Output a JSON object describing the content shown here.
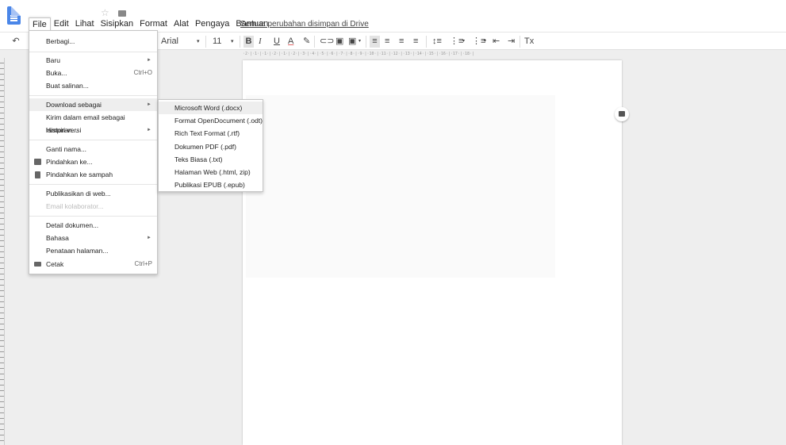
{
  "menubar": {
    "items": [
      "File",
      "Edit",
      "Lihat",
      "Sisipkan",
      "Format",
      "Alat",
      "Pengaya",
      "Bantuan"
    ],
    "saved_status": "Semua perubahan disimpan di Drive"
  },
  "toolbar": {
    "undo": "↶",
    "font": "Arial",
    "font_size": "11",
    "bold": "B",
    "italic": "I",
    "underline": "U",
    "text_color": "A",
    "clear_format": "Tx"
  },
  "ruler_text": "·2·|·1·|·1·|·2·|·1·|·2·|·3·|·4·|·5·|·6·|·7·|·8·|·9·|·10·|·11·|·12·|·13·|·14·|·15·|·16·|·17·|·18·|",
  "file_menu": {
    "share": "Berbagi...",
    "new": "Baru",
    "open": "Buka...",
    "open_shortcut": "Ctrl+O",
    "copy": "Buat salinan...",
    "download": "Download sebagai",
    "email": "Kirim dalam email sebagai lampiran...",
    "history": "Histori versi",
    "rename": "Ganti nama...",
    "move": "Pindahkan ke...",
    "trash": "Pindahkan ke sampah",
    "publish": "Publikasikan di web...",
    "email_collab": "Email kolaborator...",
    "details": "Detail dokumen...",
    "language": "Bahasa",
    "page_setup": "Penataan halaman...",
    "print": "Cetak",
    "print_shortcut": "Ctrl+P"
  },
  "download_submenu": {
    "items": [
      "Microsoft Word (.docx)",
      "Format OpenDocument (.odt)",
      "Rich Text Format (.rtf)",
      "Dokumen PDF (.pdf)",
      "Teks Biasa (.txt)",
      "Halaman Web (.html, zip)",
      "Publikasi EPUB (.epub)"
    ]
  },
  "colors": {
    "doc_blue": "#4a86e8",
    "highlight": "#eeeeee"
  }
}
